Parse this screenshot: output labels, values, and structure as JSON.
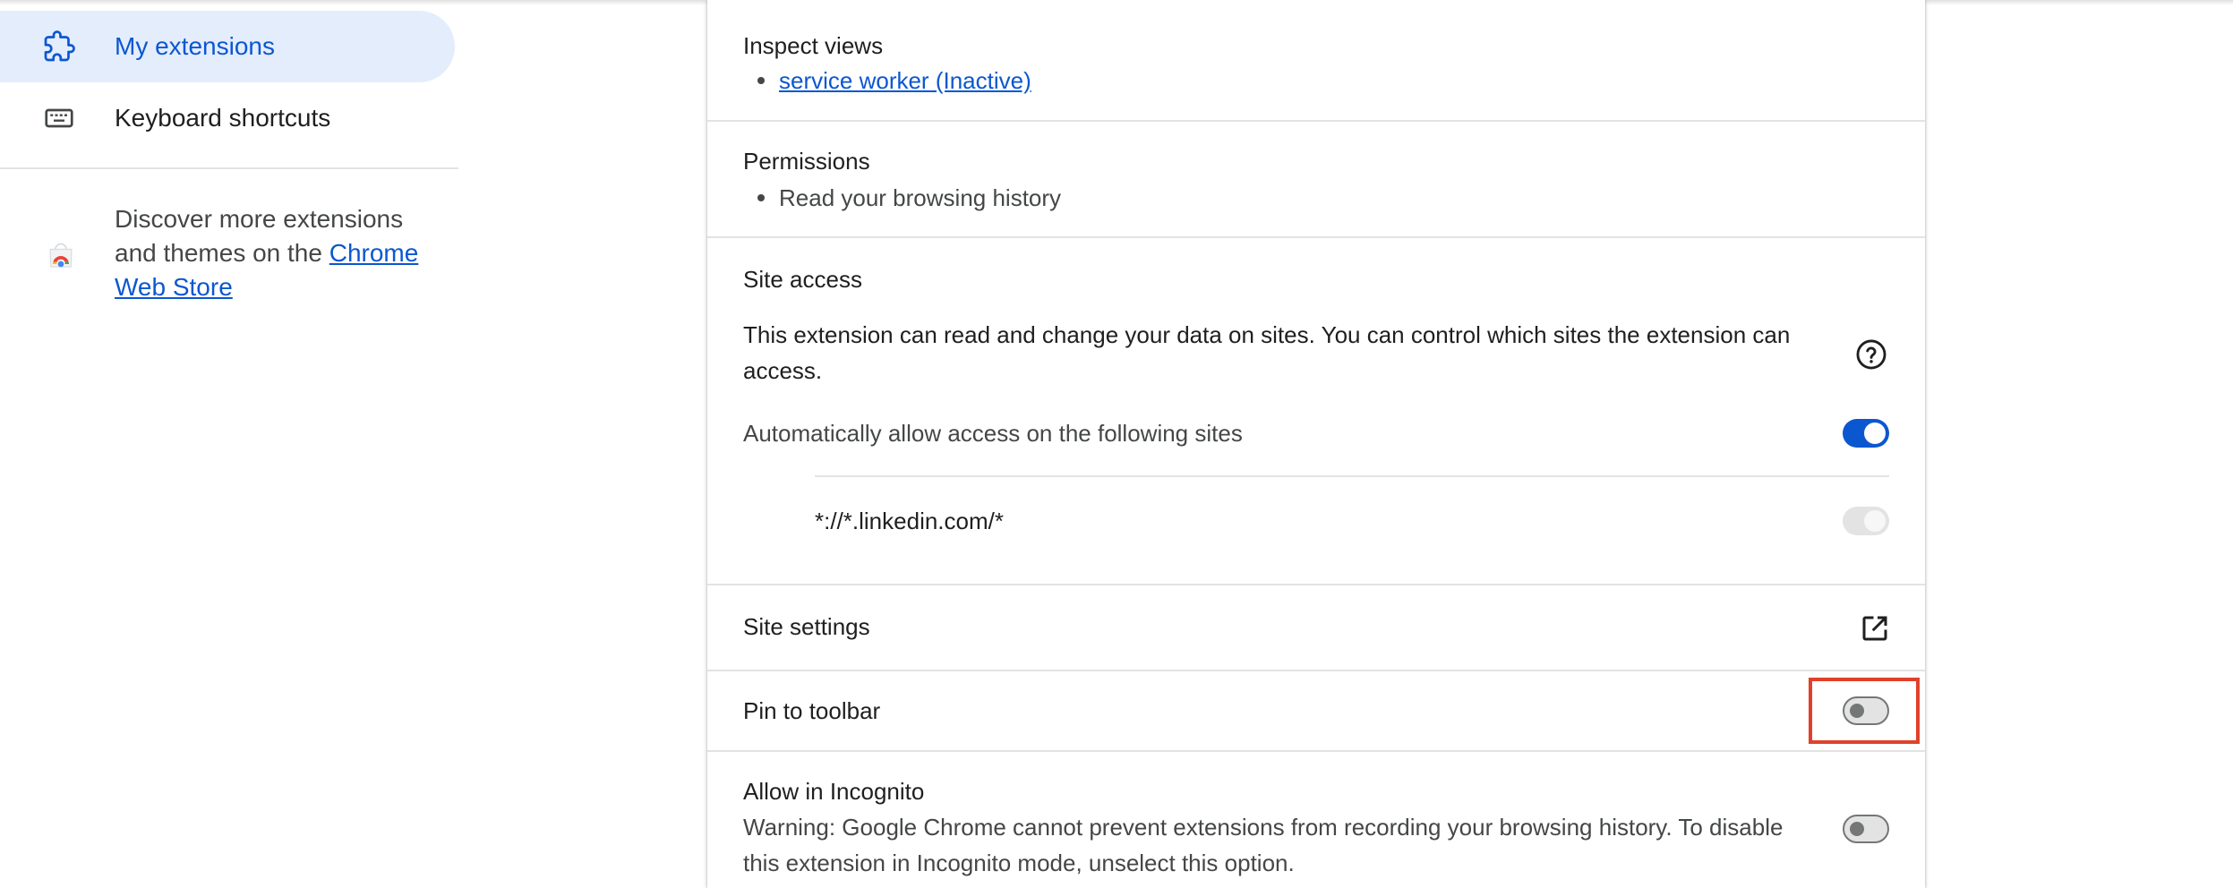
{
  "sidebar": {
    "items": [
      {
        "label": "My extensions",
        "icon": "extension-puzzle-icon",
        "selected": true
      },
      {
        "label": "Keyboard shortcuts",
        "icon": "keyboard-icon",
        "selected": false
      }
    ],
    "discover": {
      "text_before": "Discover more extensions and themes on the ",
      "link_text": "Chrome Web Store",
      "icon": "chrome-web-store-icon"
    }
  },
  "details": {
    "inspect_views": {
      "title": "Inspect views",
      "items": [
        "service worker (Inactive)"
      ]
    },
    "permissions": {
      "title": "Permissions",
      "items": [
        "Read your browsing history"
      ]
    },
    "site_access": {
      "title": "Site access",
      "description": "This extension can read and change your data on sites. You can control which sites the extension can access.",
      "auto_allow_label": "Automatically allow access on the following sites",
      "auto_allow_enabled": true,
      "sites": [
        {
          "pattern": "*://*.linkedin.com/*",
          "enabled": true,
          "disabled": true
        }
      ]
    },
    "site_settings": {
      "label": "Site settings",
      "icon": "open-in-new-icon"
    },
    "pin_to_toolbar": {
      "label": "Pin to toolbar",
      "enabled": false
    },
    "incognito": {
      "title": "Allow in Incognito",
      "warning": "Warning: Google Chrome cannot prevent extensions from recording your browsing history. To disable this extension in Incognito mode, unselect this option.",
      "enabled": false
    }
  },
  "colors": {
    "accent": "#0b57d0",
    "selected_nav_bg": "#e4edfc",
    "highlight": "#e0412a"
  }
}
